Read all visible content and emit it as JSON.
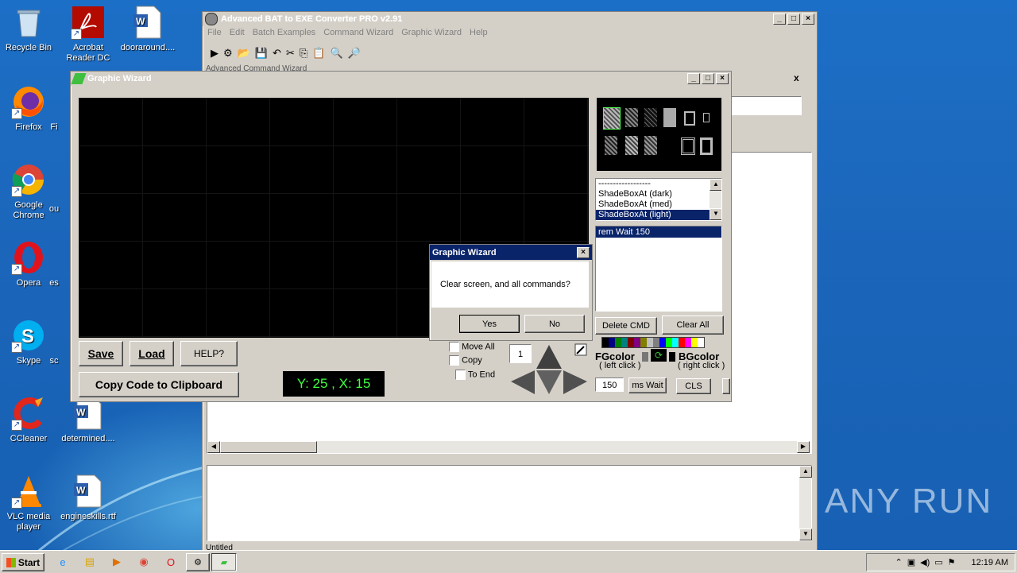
{
  "desktop": {
    "icons": [
      {
        "label": "Recycle Bin",
        "icon": "recycle-bin-icon"
      },
      {
        "label": "Acrobat Reader DC",
        "icon": "acrobat-icon"
      },
      {
        "label": "dooraround....",
        "icon": "word-doc-icon"
      },
      {
        "label": "Firefox",
        "icon": "firefox-icon"
      },
      {
        "label": "Fi",
        "icon": "partial-icon"
      },
      {
        "label": "Google Chrome",
        "icon": "chrome-icon"
      },
      {
        "label": "ou",
        "icon": "partial-icon"
      },
      {
        "label": "Opera",
        "icon": "opera-icon"
      },
      {
        "label": "es",
        "icon": "partial-icon"
      },
      {
        "label": "Skype",
        "icon": "skype-icon"
      },
      {
        "label": "sc",
        "icon": "partial-icon"
      },
      {
        "label": "CCleaner",
        "icon": "ccleaner-icon"
      },
      {
        "label": "determined....",
        "icon": "word-doc-icon"
      },
      {
        "label": "VLC media player",
        "icon": "vlc-icon"
      },
      {
        "label": "engineskills.rtf",
        "icon": "word-doc-icon"
      }
    ]
  },
  "main_window": {
    "title": "Advanced BAT to EXE Converter PRO v2.91",
    "menu": [
      "File",
      "Edit",
      "Batch Examples",
      "Command Wizard",
      "Graphic Wizard",
      "Help"
    ],
    "panel_label": "Advanced Command Wizard",
    "panel_close": "x",
    "status": "Untitled"
  },
  "graphic_wizard": {
    "title": "Graphic Wizard",
    "command_list": [
      "------------------",
      "ShadeBoxAt (dark)",
      "ShadeBoxAt (med)",
      "ShadeBoxAt (light)"
    ],
    "selected_command": "ShadeBoxAt (light)",
    "script_lines": [
      "rem Wait 150"
    ],
    "buttons": {
      "save": "Save",
      "load": "Load",
      "help": "HELP?",
      "copy": "Copy Code to Clipboard",
      "delete_cmd": "Delete CMD",
      "clear_all": "Clear All",
      "ms_wait": "ms Wait",
      "cls": "CLS"
    },
    "coords": "Y: 25 , X: 15",
    "options": {
      "move_all": "Move All",
      "copy": "Copy",
      "to_end": "To End"
    },
    "step_value": "1",
    "wait_value": "150",
    "fg_label": "FGcolor",
    "fg_hint": "( left click )",
    "bg_label": "BGcolor",
    "bg_hint": "( right click )",
    "palette": [
      "#000000",
      "#000080",
      "#008000",
      "#008080",
      "#800000",
      "#800080",
      "#808000",
      "#c0c0c0",
      "#808080",
      "#0000ff",
      "#00ff00",
      "#00ffff",
      "#ff0000",
      "#ff00ff",
      "#ffff00",
      "#ffffff"
    ]
  },
  "dialog": {
    "title": "Graphic Wizard",
    "message": "Clear screen, and all commands?",
    "yes": "Yes",
    "no": "No"
  },
  "taskbar": {
    "start": "Start",
    "clock": "12:19 AM"
  },
  "watermark": "ANY RUN"
}
